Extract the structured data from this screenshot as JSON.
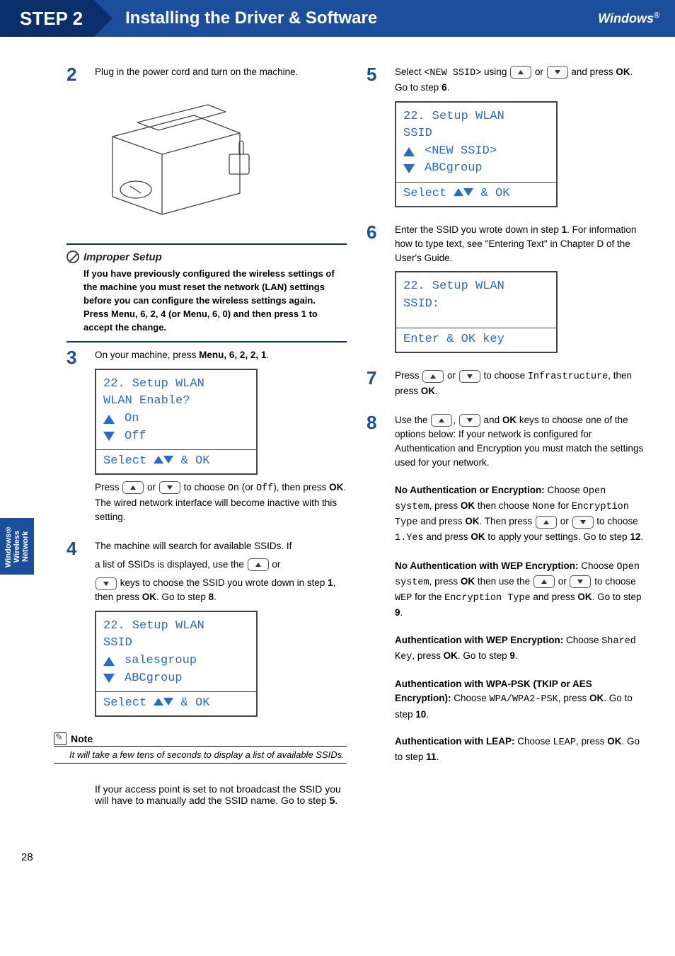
{
  "header": {
    "step": "STEP 2",
    "title": "Installing the Driver & Software",
    "os": "Windows",
    "reg": "®"
  },
  "side_tab": "Windows® Wireless Network",
  "left": {
    "s2": {
      "num": "2",
      "text": "Plug in the power cord and turn on the machine."
    },
    "improper": {
      "title": "Improper Setup",
      "body": "If you have previously configured the wireless settings of the machine you must reset the network (LAN) settings before you can configure the wireless settings again.",
      "body2": "Press Menu, 6, 2, 4 (or Menu, 6, 0) and then press 1 to accept the change."
    },
    "s3": {
      "num": "3",
      "a": "On your machine, press ",
      "menu": "Menu",
      "seq": ", 6, 2, 2, 1",
      "dot": ".",
      "lcd": {
        "l1": "22. Setup WLAN",
        "l2": "  WLAN Enable?",
        "l3": "On",
        "l4": "Off",
        "sel": "Select ab & OK"
      },
      "p1a": "Press ",
      "p1b": " or ",
      "p1c": " to choose ",
      "on": "On",
      "or_off": " (or ",
      "off": "Off",
      "p1d": "), then press ",
      "ok": "OK",
      "p1e": ". The wired network interface will become inactive with this setting."
    },
    "s4": {
      "num": "4",
      "p1": "The machine will search for available SSIDs. If",
      "p2a": "a list of SSIDs is displayed, use the ",
      "p2b": " or",
      "p3a": " keys to choose the SSID you wrote down in step ",
      "p3b": "1",
      "p3c": ", then press ",
      "p3d": "OK",
      "p3e": ". Go to step ",
      "p3f": "8",
      "p3g": ".",
      "lcd": {
        "l1": "22. Setup WLAN",
        "l2": " SSID",
        "l3": "salesgroup",
        "l4": "ABCgroup",
        "sel": "Select ab & OK"
      }
    },
    "note": {
      "title": "Note",
      "body": "It will take a few tens of seconds to display a list of available SSIDs."
    },
    "after_note": {
      "p1": "If your access point is set to not broadcast the SSID you will have to manually add the SSID name. Go to step ",
      "p2": "5",
      "p3": "."
    }
  },
  "right": {
    "s5": {
      "num": "5",
      "a": "Select ",
      "ssid": "<NEW SSID>",
      "b": " using ",
      "c": " or ",
      "d": " and press ",
      "ok": "OK",
      "e": ". Go to step ",
      "f": "6",
      "g": ".",
      "lcd": {
        "l1": "22. Setup WLAN",
        "l2": " SSID",
        "l3": "<NEW SSID>",
        "l4": "ABCgroup",
        "sel": "Select ab & OK"
      }
    },
    "s6": {
      "num": "6",
      "p1": "Enter the SSID you wrote down in step ",
      "p1b": "1",
      "p1c": ". For information how to type text, see \"Entering Text\" in Chapter D of the User's Guide.",
      "lcd": {
        "l1": "22. Setup WLAN",
        "l2": " SSID:",
        "sel": "Enter & OK key"
      }
    },
    "s7": {
      "num": "7",
      "a": "Press ",
      "b": " or ",
      "c": " to choose ",
      "infra": "Infrastructure",
      "d": ", then press ",
      "ok": "OK",
      "e": "."
    },
    "s8": {
      "num": "8",
      "a": "Use the ",
      "b": ", ",
      "c": " and ",
      "ok": "OK",
      "d": " keys to choose one of the options below: If your network is configured for Authentication and Encryption you must match the settings used for your network.",
      "noauth_noenc": {
        "t": "No Authentication or Encryption:",
        "a": " Choose ",
        "open": "Open system",
        "b": ", press ",
        "ok": "OK",
        "c": " then choose ",
        "none": "None",
        "d": " for ",
        "enc": "Encryption Type",
        "e": " and press ",
        "ok2": "OK",
        "f": ". Then press ",
        "g": " or ",
        "h": " to choose ",
        "yes": "1.Yes",
        "i": " and press ",
        "ok3": "OK",
        "j": " to apply your settings. Go to step ",
        "k": "12",
        "l": "."
      },
      "noauth_wep": {
        "t": "No Authentication with WEP Encryption:",
        "a": " Choose ",
        "open": "Open system",
        "b": ", press ",
        "ok": "OK",
        "c": " then use the ",
        "d": " or ",
        "e": " to choose ",
        "wep": "WEP",
        "f": " for the ",
        "enc": "Encryption Type",
        "g": " and press ",
        "ok2": "OK",
        "h": ". Go to step ",
        "i": "9",
        "j": "."
      },
      "auth_wep": {
        "t": "Authentication with WEP Encryption:",
        "a": " Choose ",
        "shared": "Shared Key",
        "b": ", press ",
        "ok": "OK",
        "c": ". Go to step ",
        "d": "9",
        "e": "."
      },
      "wpa": {
        "t": "Authentication with WPA-PSK (TKIP or AES Encryption):",
        "a": " Choose ",
        "wpa": "WPA/WPA2-PSK",
        "b": ", press ",
        "ok": "OK",
        "c": ". Go to step ",
        "d": "10",
        "e": "."
      },
      "leap": {
        "t": "Authentication with LEAP:",
        "a": " Choose ",
        "leap": "LEAP",
        "b": ", press ",
        "ok": "OK",
        "c": ". Go to step ",
        "d": "11",
        "e": "."
      }
    }
  },
  "page_number": "28"
}
